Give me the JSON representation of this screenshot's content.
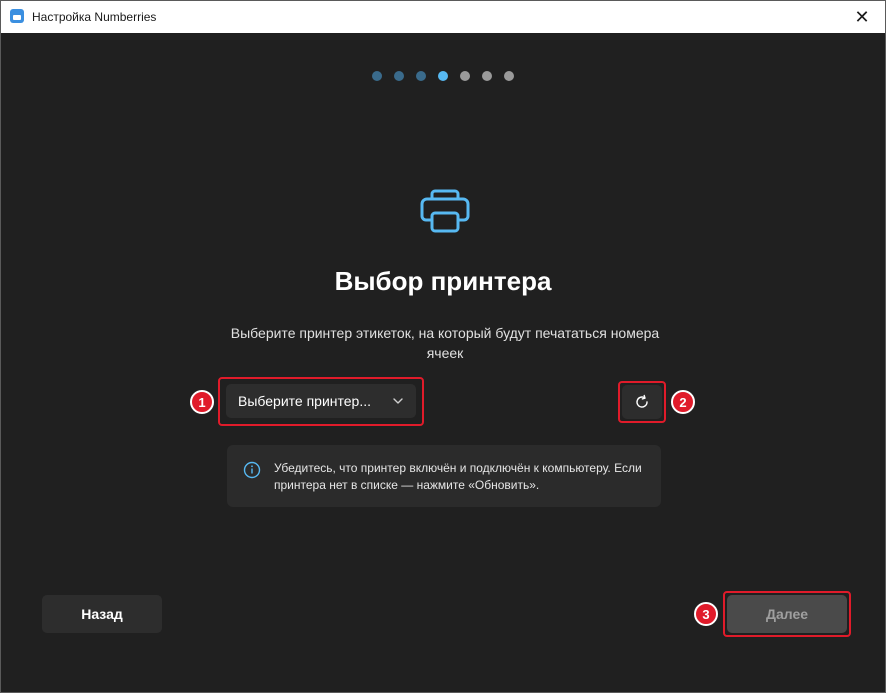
{
  "window": {
    "title": "Настройка Numberries",
    "close_glyph": "✕"
  },
  "steps": {
    "total": 7,
    "active_index": 3
  },
  "page": {
    "icon": "printer-icon",
    "heading": "Выбор принтера",
    "subtitle": "Выберите принтер этикеток, на который будут печататься номера ячеек"
  },
  "printer_select": {
    "placeholder": "Выберите принтер...",
    "icon": "chevron-down-icon"
  },
  "refresh": {
    "icon": "refresh-icon"
  },
  "info": {
    "icon": "info-icon",
    "text": "Убедитесь, что принтер включён и подключён к компьютеру. Если принтера нет в списке — нажмите «Обновить»."
  },
  "buttons": {
    "back": "Назад",
    "next": "Далее"
  },
  "annotations": [
    "1",
    "2",
    "3"
  ],
  "colors": {
    "accent": "#57b9f2",
    "annotation_red": "#e01b2a",
    "background": "#202020"
  }
}
